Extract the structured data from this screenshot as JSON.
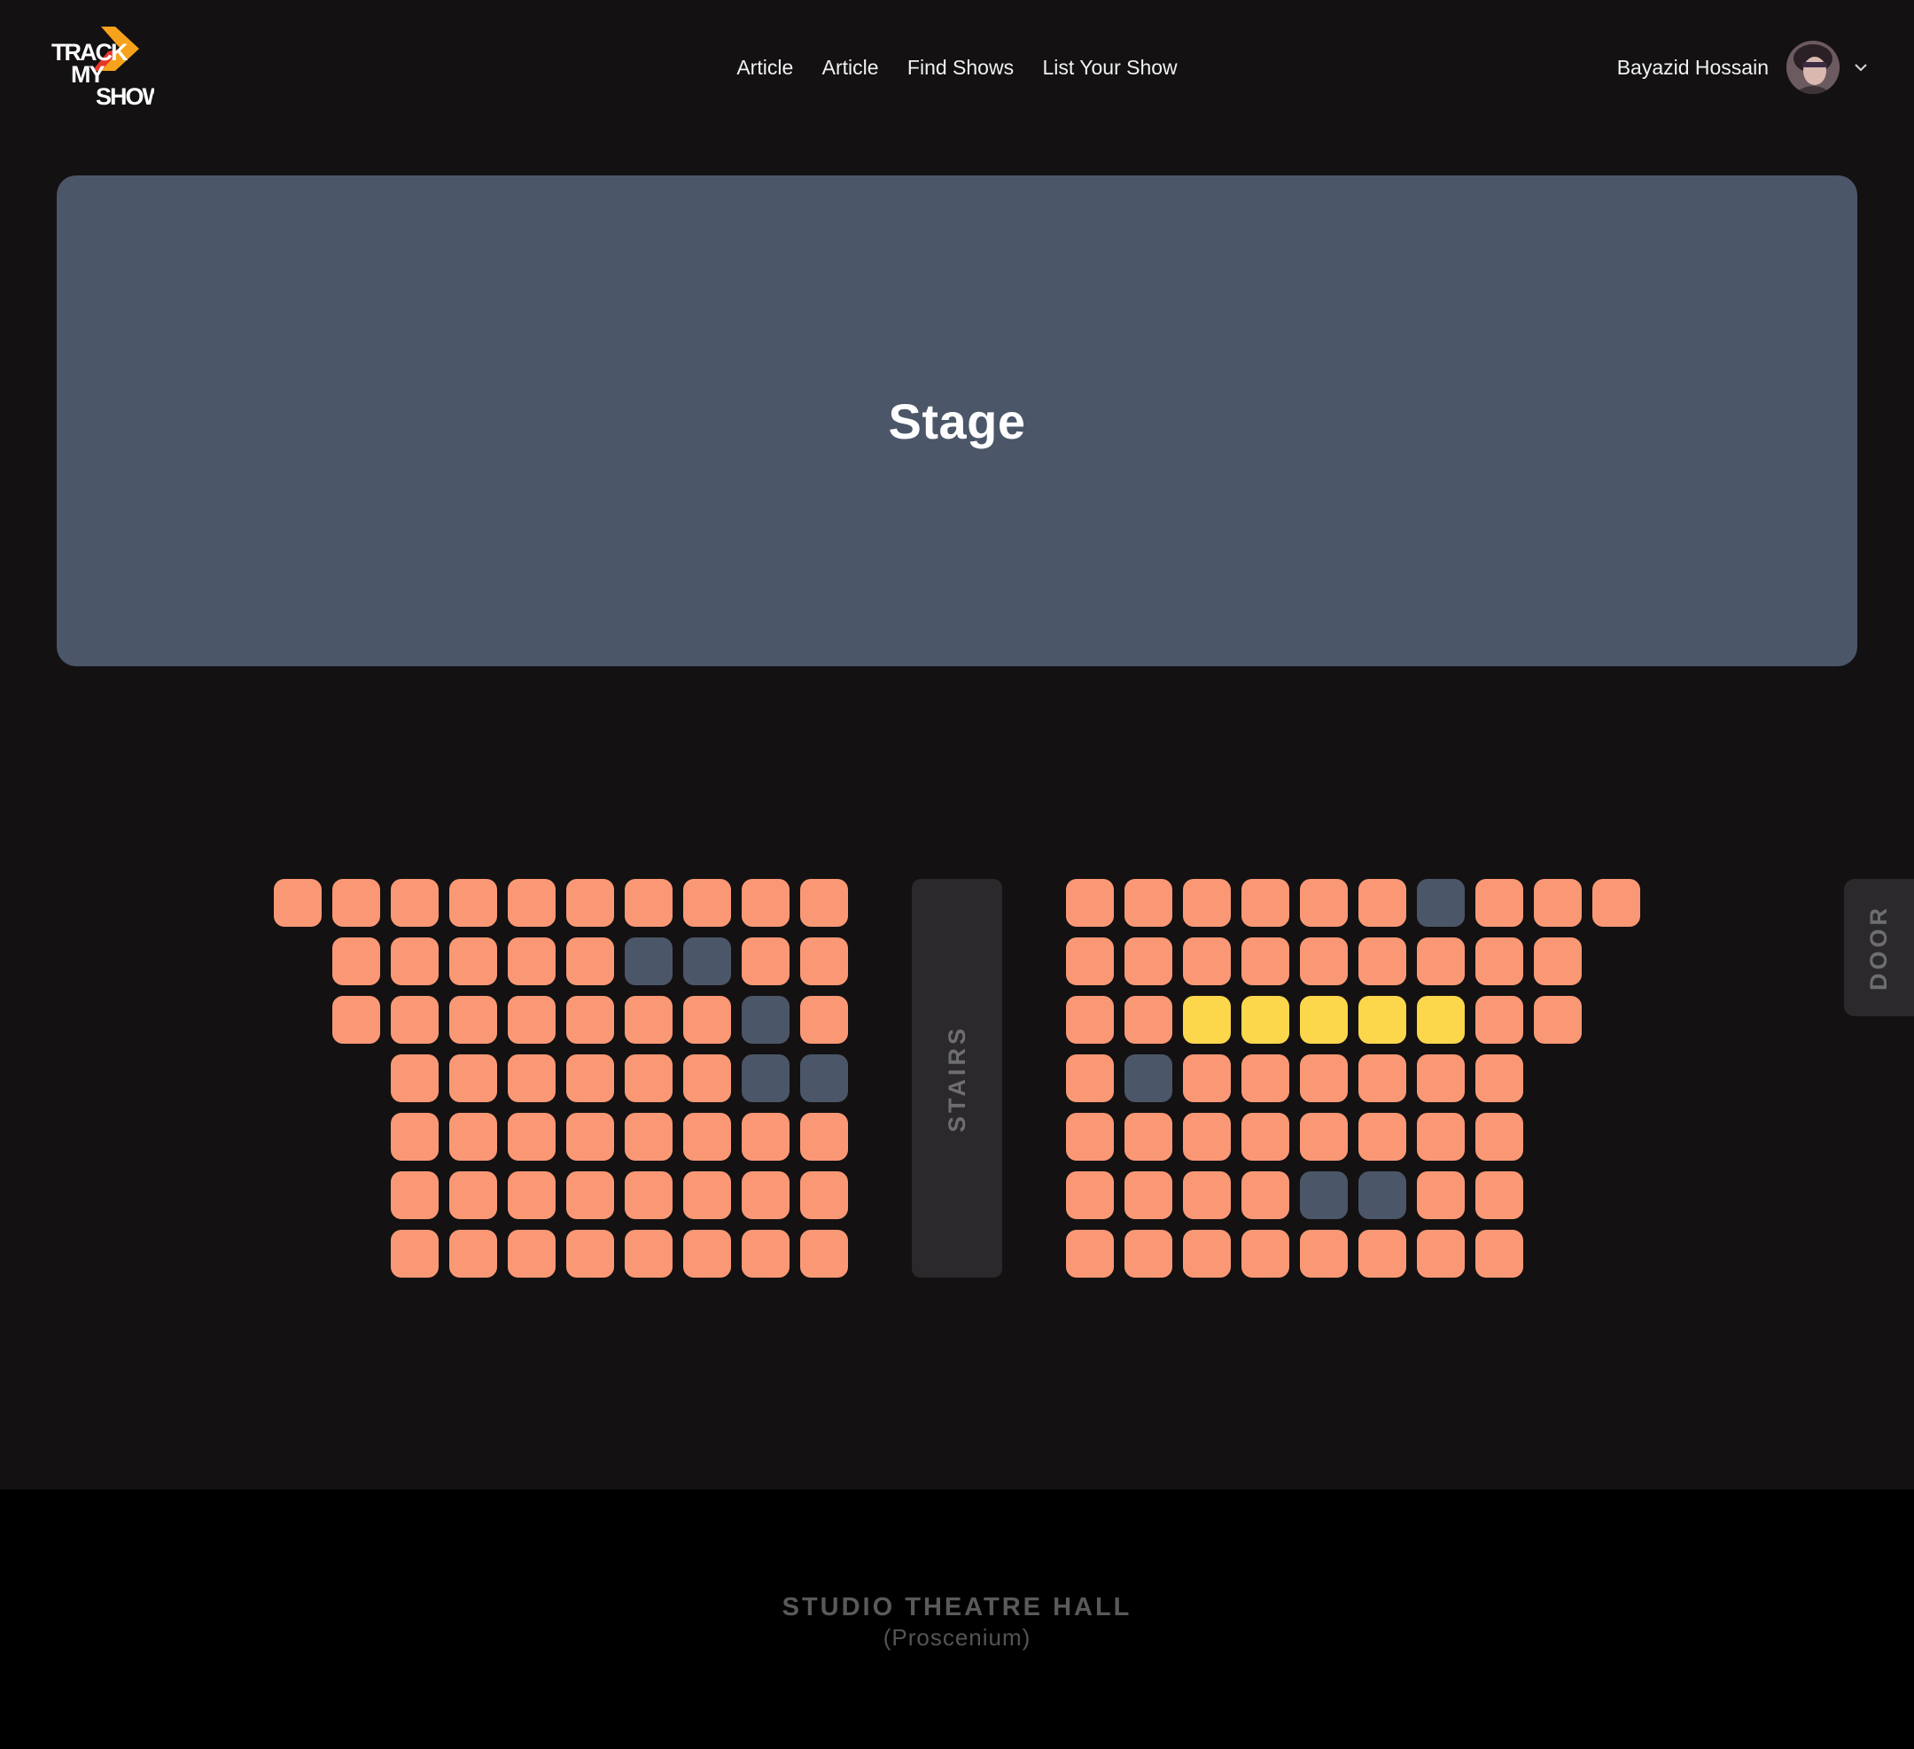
{
  "header": {
    "logo": {
      "line1": "TRACK",
      "line2": "MY",
      "line3": "SHOW"
    },
    "nav": [
      "Article",
      "Article",
      "Find Shows",
      "List Your Show"
    ],
    "user": {
      "name": "Bayazid Hossain",
      "avatar_icon": "avatar-photo",
      "menu_icon": "chevron-down-icon"
    }
  },
  "stage": {
    "label": "Stage"
  },
  "hall": {
    "stairs_label": "STAIRS",
    "door_label": "DOOR",
    "name": "STUDIO THEATRE HALL",
    "type": "(Proscenium)"
  },
  "colors": {
    "background": "#131112",
    "available": "#fa9875",
    "booked": "#4b5668",
    "selected": "#fcd64b",
    "stage": "#4b5668",
    "footer": "#000000"
  },
  "seating": {
    "left_block": [
      "AAAAAAAAAA",
      " AAAAABBAA",
      " AAAAAAABA",
      "  AAAAAABB",
      "  AAAAAAAA",
      "  AAAAAAAA",
      "  AAAAAAAA"
    ],
    "right_block": [
      "AAAAAABAAA",
      "AAAAAAAAA",
      "AASSSSSAA",
      "ABAAAAAA",
      "AAAAAAAA",
      "AAAABBAA",
      "AAAAAAAA"
    ]
  }
}
